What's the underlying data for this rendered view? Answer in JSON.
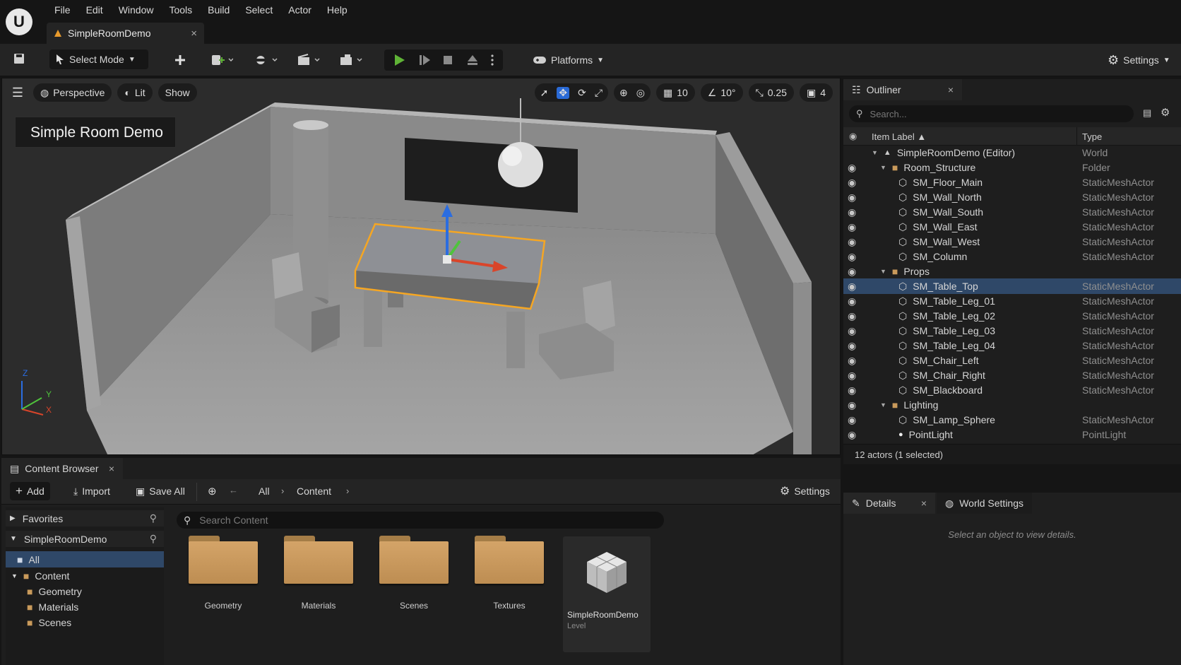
{
  "menubar": {
    "logo": "U",
    "items": [
      "File",
      "Edit",
      "Window",
      "Tools",
      "Build",
      "Select",
      "Actor",
      "Help"
    ]
  },
  "tab": {
    "title": "SimpleRoomDemo",
    "close": "×"
  },
  "toolbar": {
    "select_mode": "Select Mode",
    "platforms": "Platforms",
    "settings": "Settings"
  },
  "viewport": {
    "perspective": "Perspective",
    "lit": "Lit",
    "show": "Show",
    "grid_snap": "10",
    "rot_snap": "10°",
    "scale_snap": "0.25",
    "cam_speed": "4",
    "title": "Simple Room Demo",
    "axes": {
      "z": "Z",
      "y": "Y",
      "x": "X"
    }
  },
  "outliner": {
    "title": "Outliner",
    "search_placeholder": "Search...",
    "col_label": "Item Label",
    "col_type": "Type",
    "rows": [
      {
        "label": "SimpleRoomDemo (Editor)",
        "type": "World",
        "icon": "world-icon",
        "depth": 0,
        "eye": false
      },
      {
        "label": "Room_Structure",
        "type": "Folder",
        "icon": "folder-icon",
        "depth": 1,
        "eye": true
      },
      {
        "label": "SM_Floor_Main",
        "type": "StaticMeshActor",
        "icon": "mesh-icon",
        "depth": 2,
        "eye": true
      },
      {
        "label": "SM_Wall_North",
        "type": "StaticMeshActor",
        "icon": "mesh-icon",
        "depth": 2,
        "eye": true
      },
      {
        "label": "SM_Wall_South",
        "type": "StaticMeshActor",
        "icon": "mesh-icon",
        "depth": 2,
        "eye": true
      },
      {
        "label": "SM_Wall_East",
        "type": "StaticMeshActor",
        "icon": "mesh-icon",
        "depth": 2,
        "eye": true
      },
      {
        "label": "SM_Wall_West",
        "type": "StaticMeshActor",
        "icon": "mesh-icon",
        "depth": 2,
        "eye": true
      },
      {
        "label": "SM_Column",
        "type": "StaticMeshActor",
        "icon": "mesh-icon",
        "depth": 2,
        "eye": true
      },
      {
        "label": "Props",
        "type": "",
        "icon": "folder-icon",
        "depth": 1,
        "eye": true
      },
      {
        "label": "SM_Table_Top",
        "type": "StaticMeshActor",
        "icon": "mesh-icon",
        "depth": 2,
        "eye": true,
        "selected": true
      },
      {
        "label": "SM_Table_Leg_01",
        "type": "StaticMeshActor",
        "icon": "mesh-icon",
        "depth": 2,
        "eye": true
      },
      {
        "label": "SM_Table_Leg_02",
        "type": "StaticMeshActor",
        "icon": "mesh-icon",
        "depth": 2,
        "eye": true
      },
      {
        "label": "SM_Table_Leg_03",
        "type": "StaticMeshActor",
        "icon": "mesh-icon",
        "depth": 2,
        "eye": true
      },
      {
        "label": "SM_Table_Leg_04",
        "type": "StaticMeshActor",
        "icon": "mesh-icon",
        "depth": 2,
        "eye": true
      },
      {
        "label": "SM_Chair_Left",
        "type": "StaticMeshActor",
        "icon": "mesh-icon",
        "depth": 2,
        "eye": true
      },
      {
        "label": "SM_Chair_Right",
        "type": "StaticMeshActor",
        "icon": "mesh-icon",
        "depth": 2,
        "eye": true
      },
      {
        "label": "SM_Blackboard",
        "type": "StaticMeshActor",
        "icon": "mesh-icon",
        "depth": 2,
        "eye": true
      },
      {
        "label": "Lighting",
        "type": "",
        "icon": "folder-icon",
        "depth": 1,
        "eye": true
      },
      {
        "label": "SM_Lamp_Sphere",
        "type": "StaticMeshActor",
        "icon": "mesh-icon",
        "depth": 2,
        "eye": true
      },
      {
        "label": "PointLight",
        "type": "PointLight",
        "icon": "light-icon",
        "depth": 2,
        "eye": true
      }
    ],
    "status": "12 actors (1 selected)"
  },
  "details": {
    "tab": "Details",
    "world_tab": "World Settings",
    "empty": "Select an object to view details."
  },
  "content_browser": {
    "title": "Content Browser",
    "add": "Add",
    "import": "Import",
    "save_all": "Save All",
    "crumb_all": "All",
    "crumb_content": "Content",
    "settings": "Settings",
    "search_placeholder": "Search Content",
    "favorites": "Favorites",
    "project": "SimpleRoomDemo",
    "tree": [
      {
        "label": "All",
        "depth": 0,
        "selected": true
      },
      {
        "label": "Content",
        "depth": 0
      },
      {
        "label": "Geometry",
        "depth": 1
      },
      {
        "label": "Materials",
        "depth": 1
      },
      {
        "label": "Scenes",
        "depth": 1
      }
    ],
    "assets": [
      "Geometry",
      "Materials",
      "Scenes",
      "Textures"
    ],
    "level": {
      "name": "SimpleRoomDemo",
      "kind": "Level"
    }
  },
  "colors": {
    "accent": "#2f4868",
    "play": "#5fb336",
    "selection": "#f5a623"
  }
}
